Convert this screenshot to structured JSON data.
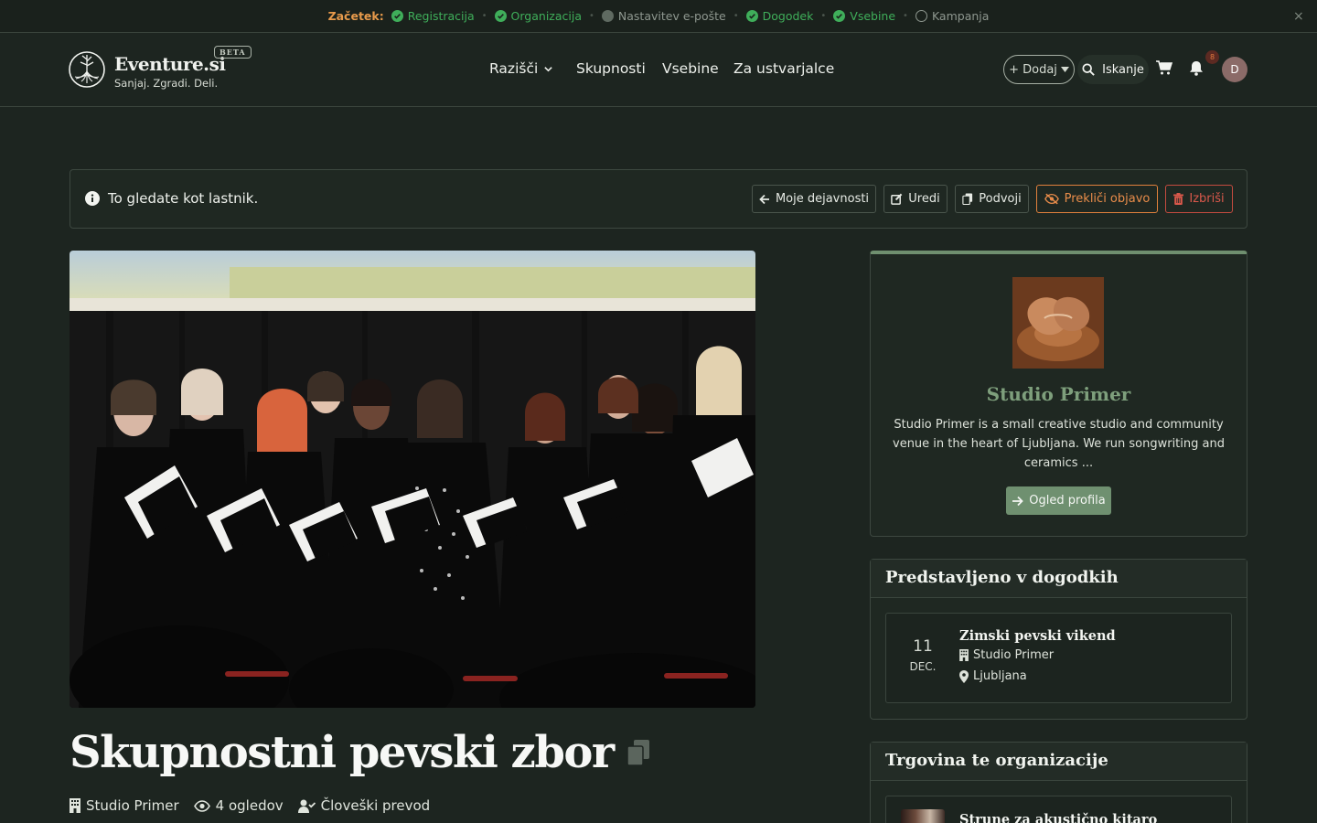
{
  "onboarding": {
    "start_label": "Začetek:",
    "steps": [
      {
        "label": "Registracija",
        "done": true
      },
      {
        "label": "Organizacija",
        "done": true
      },
      {
        "label": "Nastavitev e-pošte",
        "done": false,
        "state": "partial"
      },
      {
        "label": "Dogodek",
        "done": true
      },
      {
        "label": "Vsebine",
        "done": true
      },
      {
        "label": "Kampanja",
        "done": false,
        "state": "empty"
      }
    ],
    "close_label": "×"
  },
  "nav": {
    "brand": "Eventure.si",
    "tagline": "Sanjaj. Zgradi. Deli.",
    "beta": "BETA",
    "links": [
      {
        "label": "Razišči",
        "dropdown": true
      },
      {
        "label": "Skupnosti"
      },
      {
        "label": "Vsebine"
      },
      {
        "label": "Za ustvarjalce"
      }
    ],
    "add_label": "+ Dodaj",
    "search_label": "Iskanje",
    "notification_count": "8",
    "avatar_initial": "D"
  },
  "owner_bar": {
    "message": "To gledate kot lastnik.",
    "buttons": [
      {
        "label": "Moje dejavnosti",
        "icon": "arrow-left-icon"
      },
      {
        "label": "Uredi",
        "icon": "edit-icon"
      },
      {
        "label": "Podvoji",
        "icon": "copy-icon"
      },
      {
        "label": "Prekliči objavo",
        "icon": "eye-slash-icon",
        "style": "warning"
      },
      {
        "label": "Izbriši",
        "icon": "trash-icon",
        "style": "danger"
      }
    ]
  },
  "activity": {
    "title": "Skupnostni pevski zbor",
    "organizer": "Studio Primer",
    "views": "4 ogledov",
    "translation": "Človeški prevod"
  },
  "organization": {
    "name": "Studio Primer",
    "description": "Studio Primer is a small creative studio and community venue in the heart of Ljubljana. We run songwriting and ceramics ...",
    "button_label": "Ogled profila"
  },
  "featured": {
    "heading": "Predstavljeno v dogodkih",
    "events": [
      {
        "day": "11",
        "month": "DEC.",
        "title": "Zimski pevski vikend",
        "organizer": "Studio Primer",
        "location": "Ljubljana"
      }
    ]
  },
  "shop": {
    "heading": "Trgovina te organizacije",
    "items": [
      {
        "name": "Strune za akustično kitaro"
      }
    ]
  },
  "colors": {
    "background": "#1d2520",
    "accent_green": "#6f9070",
    "success": "#3fae5a",
    "warning": "#e98c4a",
    "danger": "#d9584b"
  }
}
